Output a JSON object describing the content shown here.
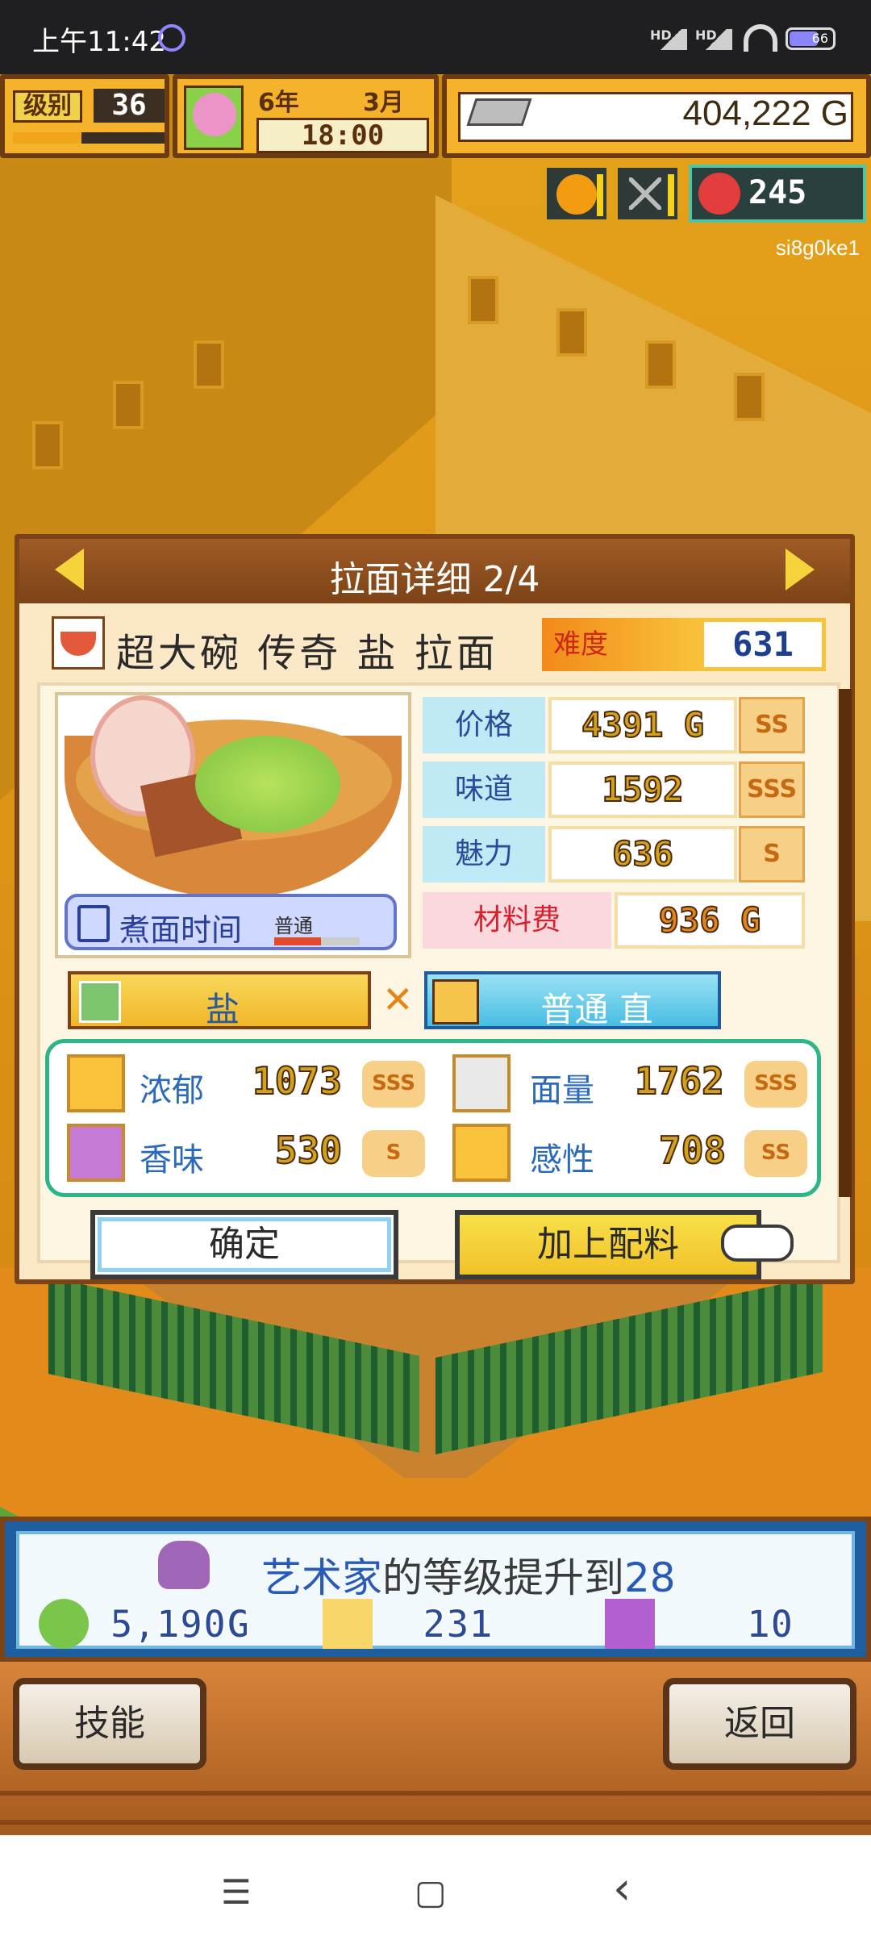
{
  "status_bar": {
    "time": "上午11:42",
    "signal1": "HD",
    "signal2": "HD",
    "battery": "66"
  },
  "hud": {
    "level_label": "级别",
    "level_value": "36",
    "level_progress": 0.45,
    "year_text": "6年",
    "month_text": "3月",
    "clock": "18:00",
    "money": "404,222 G",
    "alert_count": "245",
    "player_tag": "si8g0ke1"
  },
  "dialog": {
    "title": "拉面详细 2/4",
    "ramen_name": "超大碗 传奇 盐 拉面",
    "difficulty_label": "难度",
    "difficulty_value": "631",
    "cook_time_label": "煮面时间",
    "cook_time_value": "普通",
    "stats": [
      {
        "label": "价格",
        "value": "4391",
        "unit": "G",
        "rank": "SS"
      },
      {
        "label": "味道",
        "value": "1592",
        "rank": "SSS"
      },
      {
        "label": "魅力",
        "value": "636",
        "rank": "S"
      }
    ],
    "material": {
      "label": "材料费",
      "value": "936",
      "unit": "G"
    },
    "soup": "盐",
    "combo_sign": "✕",
    "noodle": "普通 直",
    "attributes": [
      {
        "label": "浓郁",
        "value": "1073",
        "rank": "SSS"
      },
      {
        "label": "面量",
        "value": "1762",
        "rank": "SSS"
      },
      {
        "label": "香味",
        "value": "530",
        "rank": "S"
      },
      {
        "label": "感性",
        "value": "708",
        "rank": "SS"
      }
    ],
    "confirm_label": "确定",
    "add_topping_label": "加上配料"
  },
  "notice": {
    "role": "艺术家",
    "message": "的等级提升到",
    "level": "28",
    "rewards": [
      {
        "icon": "money-bag-icon",
        "value": "5,190G"
      },
      {
        "icon": "spoon-icon",
        "value": "231"
      },
      {
        "icon": "purple-creature-icon",
        "value": "10"
      }
    ]
  },
  "bottom": {
    "skills_label": "技能",
    "back_label": "返回"
  },
  "navbar": {
    "menu": "☰",
    "home": "▢",
    "back": "‹"
  }
}
